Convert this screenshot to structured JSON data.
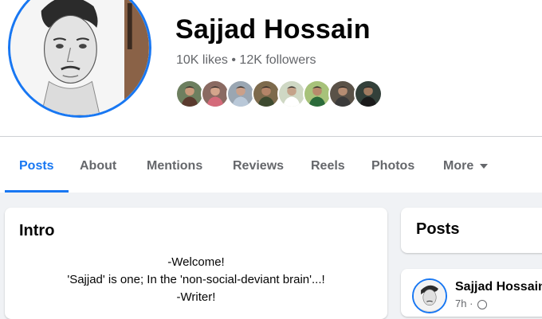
{
  "profile": {
    "name": "Sajjad Hossain",
    "stats": "10K likes • 12K followers",
    "friend_faces": [
      {
        "bg": "#6d7f5f",
        "skin": "#c99a7b",
        "shirt": "#5a3a2e"
      },
      {
        "bg": "#8a6a62",
        "skin": "#d4a58c",
        "shirt": "#d46a7a"
      },
      {
        "bg": "#9aa6b2",
        "skin": "#caa08a",
        "shirt": "#b9c8d8"
      },
      {
        "bg": "#7d6a4c",
        "skin": "#b48468",
        "shirt": "#3d4a2f"
      },
      {
        "bg": "#cfd8c4",
        "skin": "#c4a38a",
        "shirt": "#ffffff"
      },
      {
        "bg": "#a7c27a",
        "skin": "#b88a6c",
        "shirt": "#2b6b3a"
      },
      {
        "bg": "#5a5248",
        "skin": "#b58c72",
        "shirt": "#3a3a3a"
      },
      {
        "bg": "#33403a",
        "skin": "#a07a60",
        "shirt": "#1b1b1b"
      }
    ]
  },
  "tabs": [
    {
      "label": "Posts",
      "active": true
    },
    {
      "label": "About"
    },
    {
      "label": "Mentions"
    },
    {
      "label": "Reviews"
    },
    {
      "label": "Reels"
    },
    {
      "label": "Photos"
    },
    {
      "label": "More"
    }
  ],
  "intro": {
    "title": "Intro",
    "bio_lines": [
      "-Welcome!",
      "'Sajjad' is one; In the 'non-social-deviant brain'...!",
      "-Writer!"
    ]
  },
  "posts_panel": {
    "title": "Posts",
    "post": {
      "author": "Sajjad Hossain",
      "time": "7h ·"
    }
  },
  "colors": {
    "accent": "#1877f2",
    "text_primary": "#050505",
    "text_secondary": "#65676b",
    "page_bg": "#f0f2f5"
  }
}
